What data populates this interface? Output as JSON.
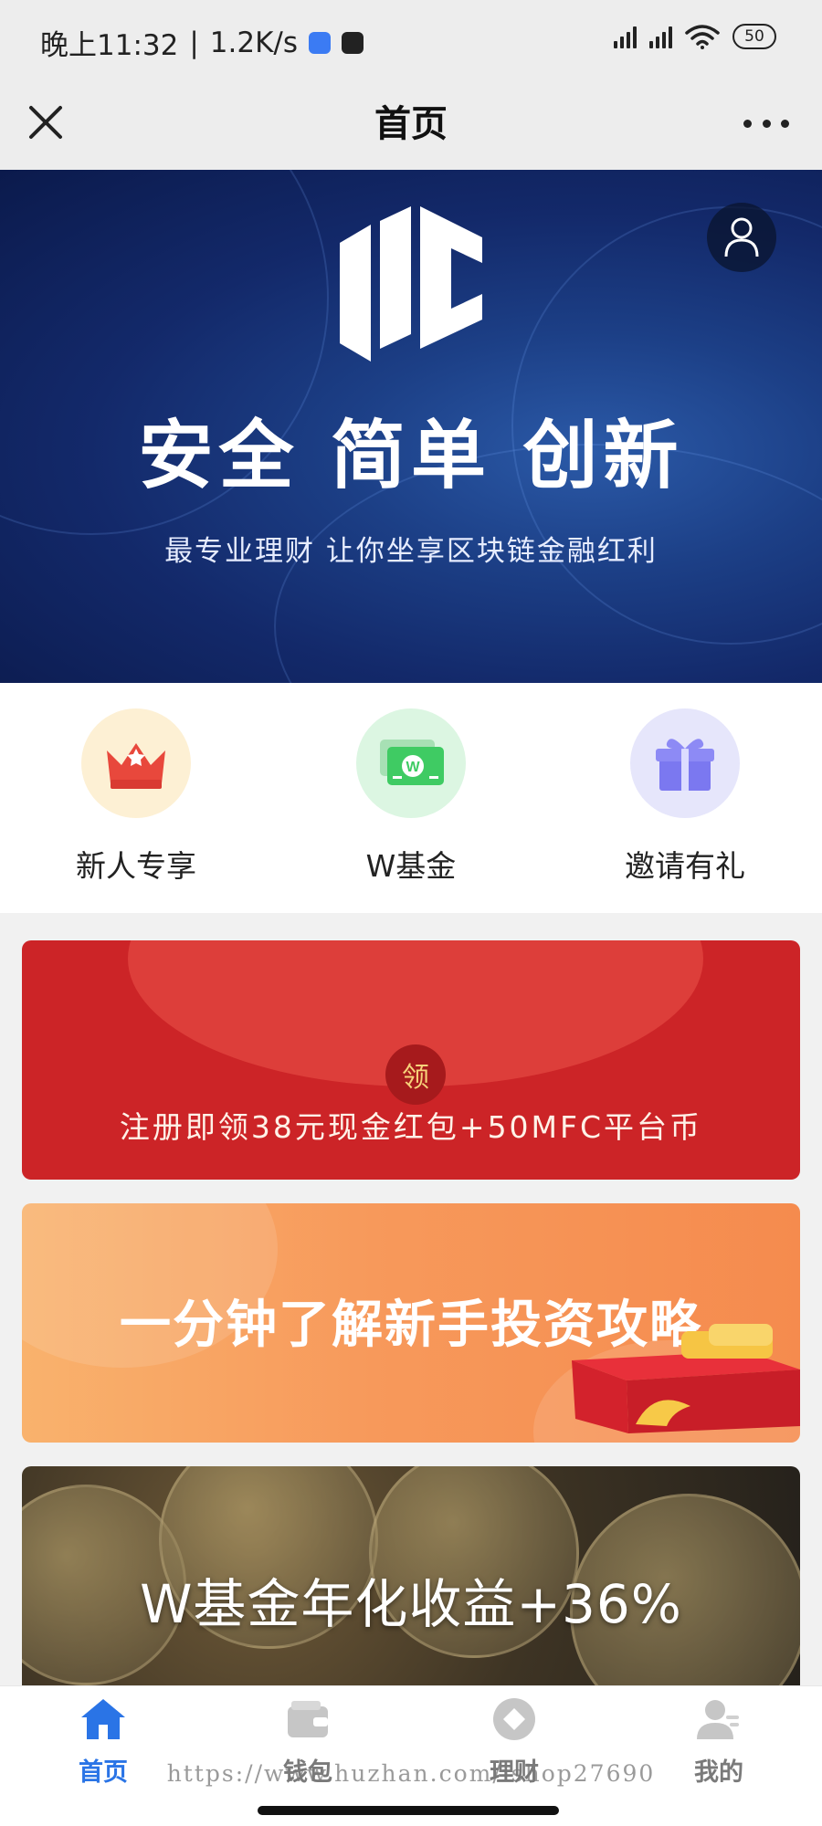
{
  "status_bar": {
    "time": "晚上11:32",
    "net_speed": "1.2K/s",
    "battery": "50"
  },
  "nav": {
    "title": "首页",
    "close_icon": "close-icon",
    "more_icon": "more-icon"
  },
  "hero": {
    "slogan": "安全  简单  创新",
    "subtitle": "最专业理财  让你坐享区块链金融红利",
    "logo_icon": "logo-mark",
    "user_icon": "user-icon"
  },
  "quick_entries": [
    {
      "label": "新人专享",
      "icon": "crown-icon",
      "bg": "#fdf0d4"
    },
    {
      "label": "W基金",
      "icon": "money-icon",
      "bg": "#dcf6e2"
    },
    {
      "label": "邀请有礼",
      "icon": "gift-icon",
      "bg": "#e6e6fb"
    }
  ],
  "promos": {
    "redpacket": {
      "badge": "领",
      "text": "注册即领38元现金红包+50MFC平台币"
    },
    "guide": {
      "text": "一分钟了解新手投资攻略"
    },
    "fund": {
      "text": "W基金年化收益+36%"
    }
  },
  "tabs": [
    {
      "label": "首页",
      "icon": "home-icon",
      "active": true
    },
    {
      "label": "钱包",
      "icon": "wallet-icon",
      "active": false
    },
    {
      "label": "理财",
      "icon": "finance-icon",
      "active": false
    },
    {
      "label": "我的",
      "icon": "profile-icon",
      "active": false
    }
  ],
  "watermark": "https://www.huzhan.com/ishop27690",
  "colors": {
    "accent": "#2a74e6",
    "red_card": "#cc2427",
    "orange_card": "#f7995b",
    "hero_bg": "#13296a"
  }
}
